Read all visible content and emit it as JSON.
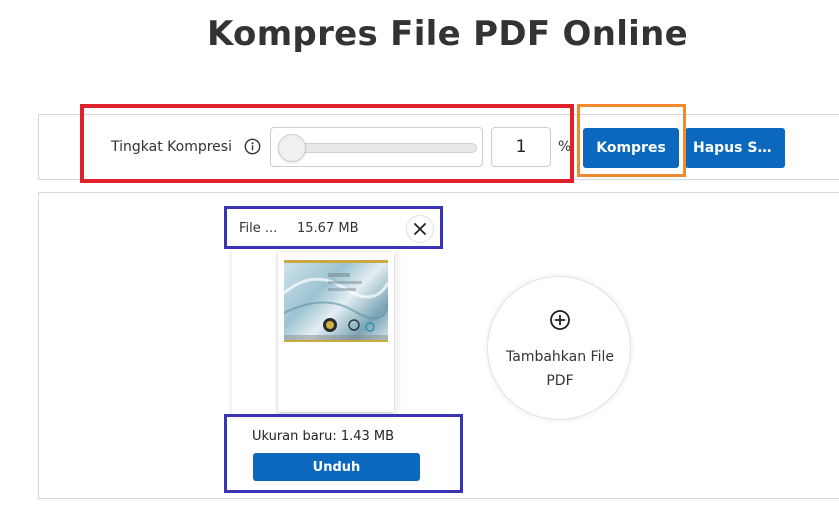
{
  "page": {
    "title": "Kompres File PDF Online"
  },
  "toolbar": {
    "compression_label": "Tingkat Kompresi",
    "compression_value": "1",
    "compression_level_percent": 1,
    "percent_sign": "%",
    "compress_button": "Kompres",
    "clear_button": "Hapus Se..."
  },
  "file_card": {
    "file_name": "File ...",
    "file_size": "15.67 MB",
    "new_size": "Ukuran baru: 1.43 MB",
    "download_button": "Unduh"
  },
  "add_file": {
    "label": "Tambahkan File PDF"
  },
  "icons": {
    "info": "info-icon",
    "close": "close-icon",
    "add": "plus-circle-icon"
  },
  "colors": {
    "primary": "#0b68bd",
    "annotation_red": "#e0202b",
    "annotation_orange": "#f08a2a",
    "annotation_blue": "#3a35b5"
  }
}
